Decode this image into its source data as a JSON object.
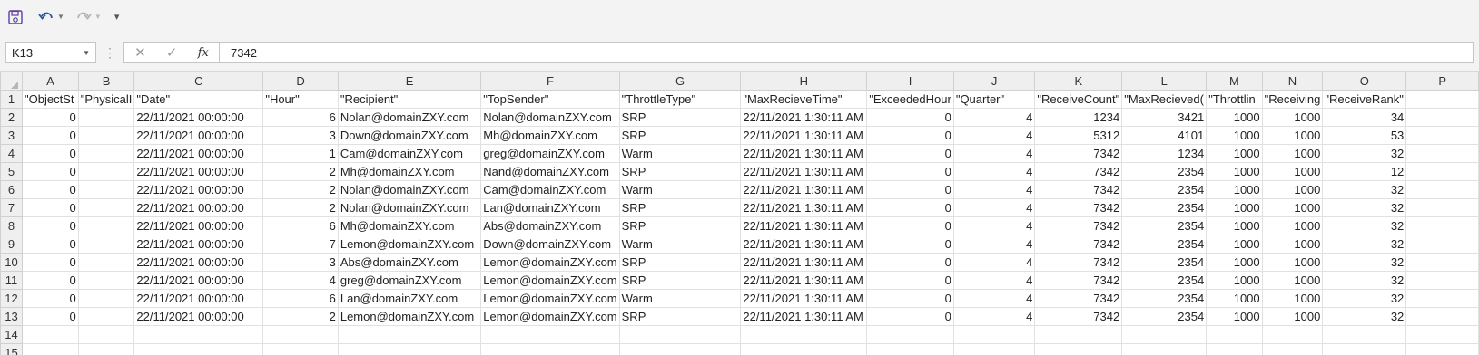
{
  "toolbar": {
    "save_icon": "save-icon",
    "undo_icon": "undo-icon",
    "redo_icon": "redo-icon",
    "customize_icon": "customize-toolbar-icon"
  },
  "formula_bar": {
    "name_box": "K13",
    "cancel_icon": "✕",
    "enter_icon": "✓",
    "fx_label": "fx",
    "value": "7342"
  },
  "columns": [
    "A",
    "B",
    "C",
    "D",
    "E",
    "F",
    "G",
    "H",
    "I",
    "J",
    "K",
    "L",
    "M",
    "N",
    "O",
    "P"
  ],
  "rows": [
    {
      "num": "1",
      "cells": [
        "\"ObjectSt",
        "\"PhysicalI",
        "\"Date\"",
        "\"Hour\"",
        "\"Recipient\"",
        "\"TopSender\"",
        "\"ThrottleType\"",
        "\"MaxRecieveTime\"",
        "\"ExceededHour",
        "\"Quarter\"",
        "\"ReceiveCount\"",
        "\"MaxRecieved(",
        "\"Throttlin",
        "\"Receiving",
        "\"ReceiveRank\"",
        ""
      ]
    },
    {
      "num": "2",
      "cells": [
        "0",
        "",
        "22/11/2021 00:00:00",
        "6",
        "Nolan@domainZXY.com",
        "Nolan@domainZXY.com",
        "SRP",
        "22/11/2021 1:30:11 AM",
        "0",
        "4",
        "1234",
        "3421",
        "1000",
        "1000",
        "34",
        ""
      ]
    },
    {
      "num": "3",
      "cells": [
        "0",
        "",
        "22/11/2021 00:00:00",
        "3",
        "Down@domainZXY.com",
        "Mh@domainZXY.com",
        "SRP",
        "22/11/2021 1:30:11 AM",
        "0",
        "4",
        "5312",
        "4101",
        "1000",
        "1000",
        "53",
        ""
      ]
    },
    {
      "num": "4",
      "cells": [
        "0",
        "",
        "22/11/2021 00:00:00",
        "1",
        "Cam@domainZXY.com",
        "greg@domainZXY.com",
        "Warm",
        "22/11/2021 1:30:11 AM",
        "0",
        "4",
        "7342",
        "1234",
        "1000",
        "1000",
        "32",
        ""
      ]
    },
    {
      "num": "5",
      "cells": [
        "0",
        "",
        "22/11/2021 00:00:00",
        "2",
        "Mh@domainZXY.com",
        "Nand@domainZXY.com",
        "SRP",
        "22/11/2021 1:30:11 AM",
        "0",
        "4",
        "7342",
        "2354",
        "1000",
        "1000",
        "12",
        ""
      ]
    },
    {
      "num": "6",
      "cells": [
        "0",
        "",
        "22/11/2021 00:00:00",
        "2",
        "Nolan@domainZXY.com",
        "Cam@domainZXY.com",
        "Warm",
        "22/11/2021 1:30:11 AM",
        "0",
        "4",
        "7342",
        "2354",
        "1000",
        "1000",
        "32",
        ""
      ]
    },
    {
      "num": "7",
      "cells": [
        "0",
        "",
        "22/11/2021 00:00:00",
        "2",
        "Nolan@domainZXY.com",
        "Lan@domainZXY.com",
        "SRP",
        "22/11/2021 1:30:11 AM",
        "0",
        "4",
        "7342",
        "2354",
        "1000",
        "1000",
        "32",
        ""
      ]
    },
    {
      "num": "8",
      "cells": [
        "0",
        "",
        "22/11/2021 00:00:00",
        "6",
        "Mh@domainZXY.com",
        "Abs@domainZXY.com",
        "SRP",
        "22/11/2021 1:30:11 AM",
        "0",
        "4",
        "7342",
        "2354",
        "1000",
        "1000",
        "32",
        ""
      ]
    },
    {
      "num": "9",
      "cells": [
        "0",
        "",
        "22/11/2021 00:00:00",
        "7",
        "Lemon@domainZXY.com",
        "Down@domainZXY.com",
        "Warm",
        "22/11/2021 1:30:11 AM",
        "0",
        "4",
        "7342",
        "2354",
        "1000",
        "1000",
        "32",
        ""
      ]
    },
    {
      "num": "10",
      "cells": [
        "0",
        "",
        "22/11/2021 00:00:00",
        "3",
        "Abs@domainZXY.com",
        "Lemon@domainZXY.com",
        "SRP",
        "22/11/2021 1:30:11 AM",
        "0",
        "4",
        "7342",
        "2354",
        "1000",
        "1000",
        "32",
        ""
      ]
    },
    {
      "num": "11",
      "cells": [
        "0",
        "",
        "22/11/2021 00:00:00",
        "4",
        "greg@domainZXY.com",
        "Lemon@domainZXY.com",
        "SRP",
        "22/11/2021 1:30:11 AM",
        "0",
        "4",
        "7342",
        "2354",
        "1000",
        "1000",
        "32",
        ""
      ]
    },
    {
      "num": "12",
      "cells": [
        "0",
        "",
        "22/11/2021 00:00:00",
        "6",
        "Lan@domainZXY.com",
        "Lemon@domainZXY.com",
        "Warm",
        "22/11/2021 1:30:11 AM",
        "0",
        "4",
        "7342",
        "2354",
        "1000",
        "1000",
        "32",
        ""
      ]
    },
    {
      "num": "13",
      "cells": [
        "0",
        "",
        "22/11/2021 00:00:00",
        "2",
        "Lemon@domainZXY.com",
        "Lemon@domainZXY.com",
        "SRP",
        "22/11/2021 1:30:11 AM",
        "0",
        "4",
        "7342",
        "2354",
        "1000",
        "1000",
        "32",
        ""
      ]
    },
    {
      "num": "14",
      "cells": [
        "",
        "",
        "",
        "",
        "",
        "",
        "",
        "",
        "",
        "",
        "",
        "",
        "",
        "",
        "",
        ""
      ]
    },
    {
      "num": "15",
      "cells": [
        "",
        "",
        "",
        "",
        "",
        "",
        "",
        "",
        "",
        "",
        "",
        "",
        "",
        "",
        "",
        ""
      ]
    }
  ]
}
